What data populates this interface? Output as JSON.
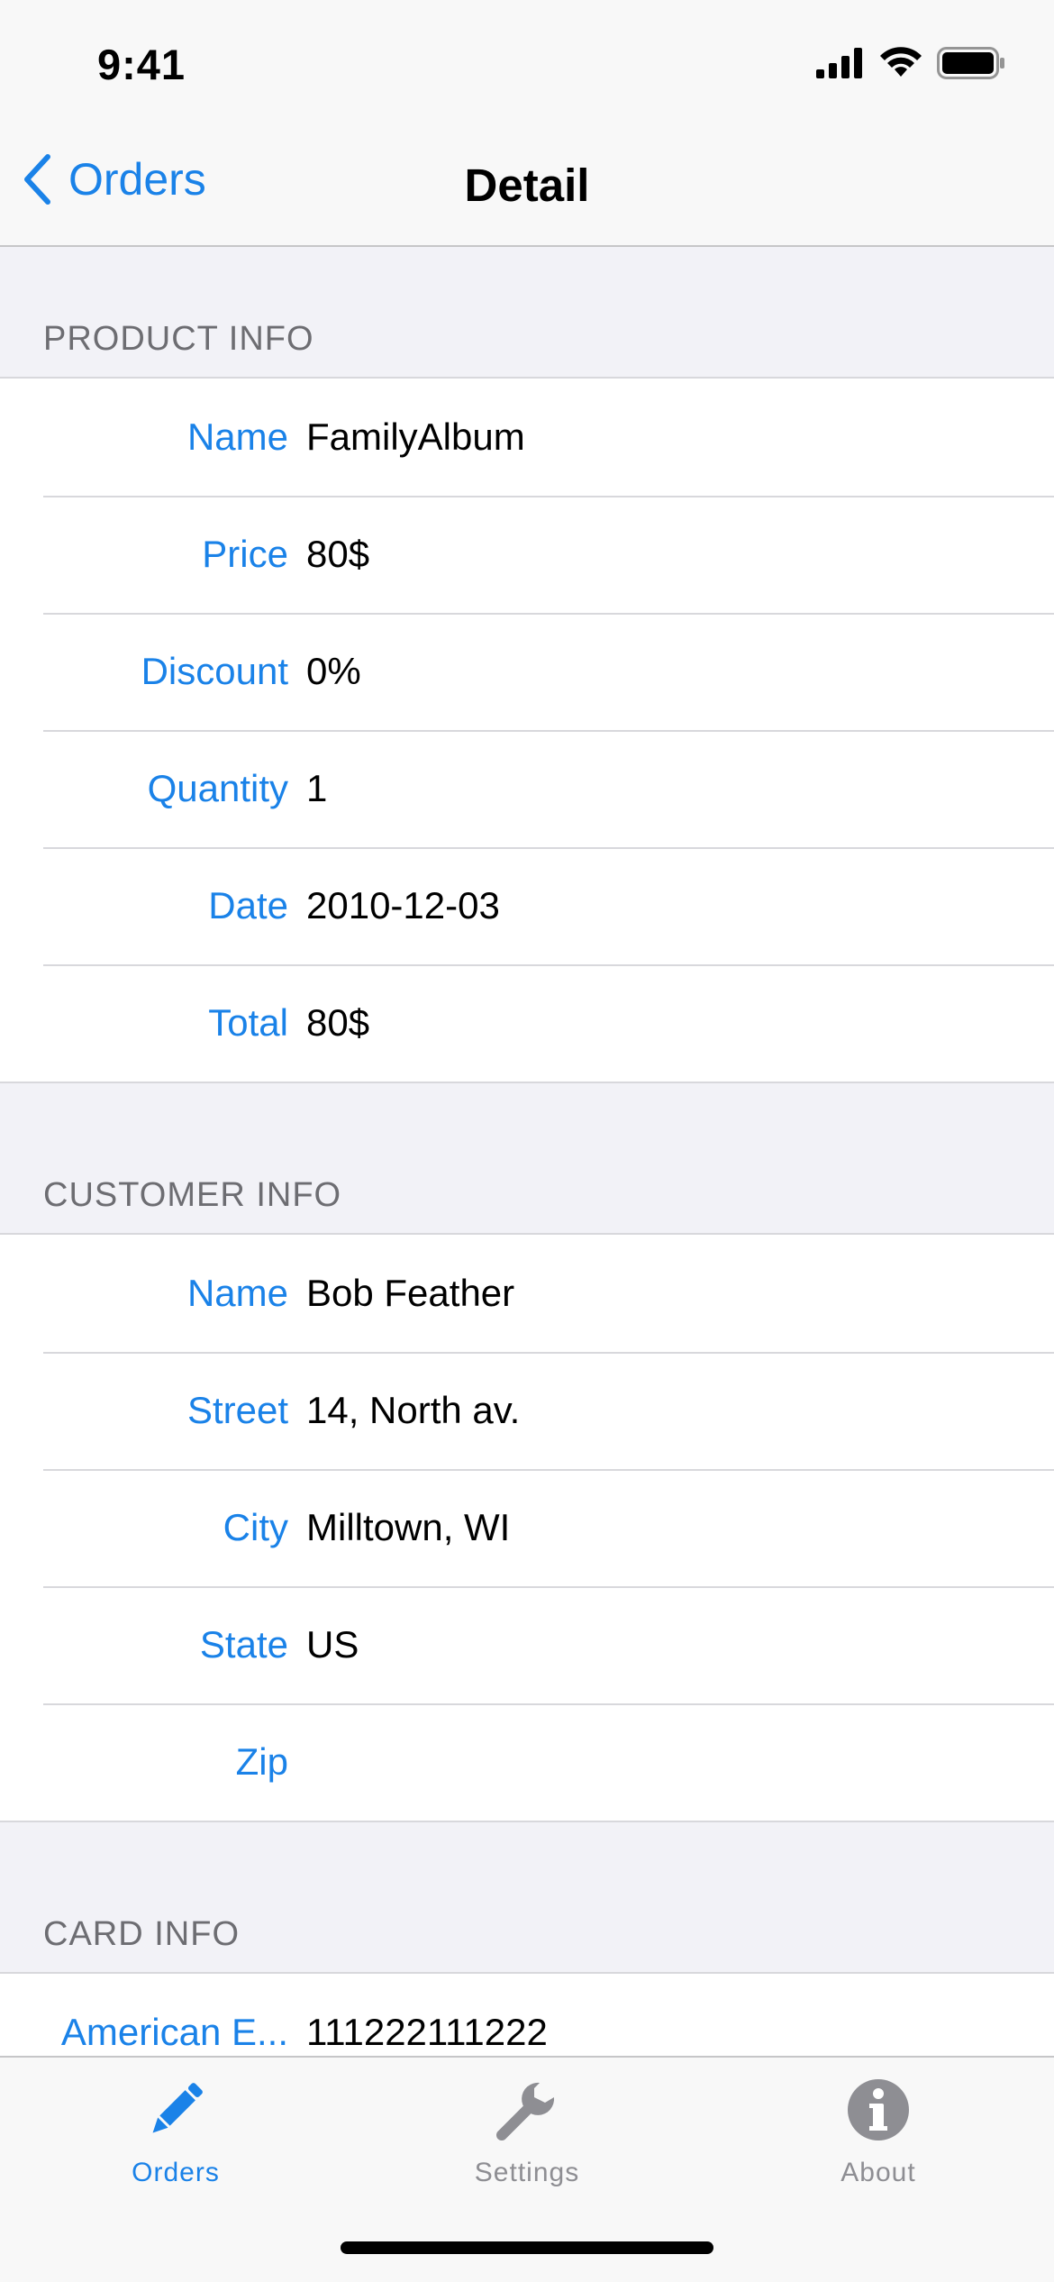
{
  "status_bar": {
    "time": "9:41"
  },
  "nav": {
    "back_label": "Orders",
    "title": "Detail"
  },
  "sections": {
    "product": {
      "header": "PRODUCT INFO",
      "rows": [
        {
          "label": "Name",
          "value": "FamilyAlbum"
        },
        {
          "label": "Price",
          "value": "80$"
        },
        {
          "label": "Discount",
          "value": "0%"
        },
        {
          "label": "Quantity",
          "value": "1"
        },
        {
          "label": "Date",
          "value": "2010-12-03"
        },
        {
          "label": "Total",
          "value": "80$"
        }
      ]
    },
    "customer": {
      "header": "CUSTOMER INFO",
      "rows": [
        {
          "label": "Name",
          "value": "Bob Feather"
        },
        {
          "label": "Street",
          "value": "14, North av."
        },
        {
          "label": "City",
          "value": "Milltown, WI"
        },
        {
          "label": "State",
          "value": "US"
        },
        {
          "label": "Zip",
          "value": ""
        }
      ]
    },
    "card": {
      "header": "CARD INFO",
      "rows": [
        {
          "label": "American E...",
          "value": "111222111222"
        }
      ]
    }
  },
  "tab_bar": {
    "tabs": [
      {
        "label": "Orders",
        "icon": "pencil-icon",
        "active": true
      },
      {
        "label": "Settings",
        "icon": "wrench-icon",
        "active": false
      },
      {
        "label": "About",
        "icon": "info-icon",
        "active": false
      }
    ]
  },
  "colors": {
    "accent": "#1a82e8",
    "inactive": "#8e8e93",
    "background": "#f2f2f7"
  }
}
